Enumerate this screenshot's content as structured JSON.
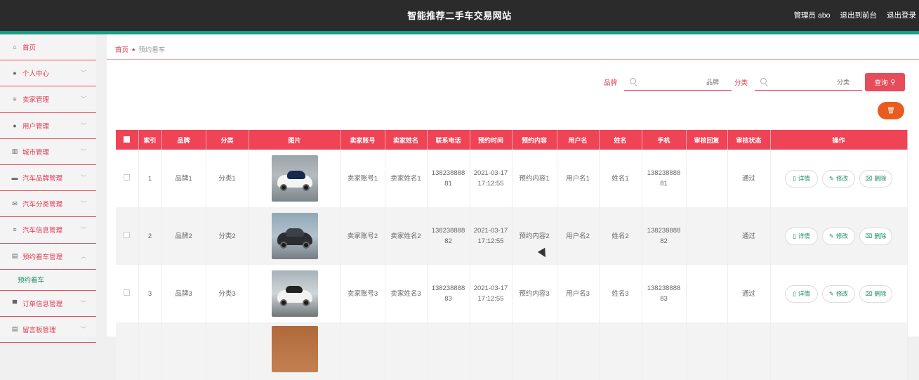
{
  "header": {
    "title": "智能推荐二手车交易网站",
    "admin": "管理员 abo",
    "back_front": "退出到前台",
    "logout": "退出登录"
  },
  "sidebar": {
    "items": [
      {
        "label": "首页",
        "icon": "home-icon",
        "chevron": false
      },
      {
        "label": "个人中心",
        "icon": "user-icon",
        "chevron": true
      },
      {
        "label": "卖家管理",
        "icon": "list-icon",
        "chevron": true
      },
      {
        "label": "用户管理",
        "icon": "user-icon",
        "chevron": true
      },
      {
        "label": "城市管理",
        "icon": "chart-icon",
        "chevron": true
      },
      {
        "label": "汽车品牌管理",
        "icon": "car-icon",
        "chevron": true
      },
      {
        "label": "汽车分类管理",
        "icon": "mail-icon",
        "chevron": true
      },
      {
        "label": "汽车信息管理",
        "icon": "list-icon",
        "chevron": true
      },
      {
        "label": "预约看车管理",
        "icon": "clipboard-icon",
        "chevron": true,
        "expanded": true
      }
    ],
    "sub_item": "预约看车",
    "items_after": [
      {
        "label": "订单信息管理",
        "icon": "print-icon",
        "chevron": true
      },
      {
        "label": "留言板管理",
        "icon": "clipboard-icon",
        "chevron": true
      }
    ]
  },
  "breadcrumb": {
    "home": "首页",
    "current": "预约看车"
  },
  "search": {
    "brand_label": "品牌",
    "brand_placeholder": "品牌",
    "category_label": "分类",
    "category_placeholder": "分类",
    "query_button": "查询"
  },
  "table": {
    "columns": [
      "索引",
      "品牌",
      "分类",
      "图片",
      "卖家账号",
      "卖家姓名",
      "联系电话",
      "预约时间",
      "预约内容",
      "用户名",
      "姓名",
      "手机",
      "审核回复",
      "审核状态",
      "操作"
    ],
    "rows": [
      {
        "index": "1",
        "brand": "品牌1",
        "category": "分类1",
        "seller_account": "卖家账号1",
        "seller_name": "卖家姓名1",
        "phone": "13823888881",
        "time": "2021-03-17 17:12:55",
        "content": "预约内容1",
        "username": "用户名1",
        "name": "姓名1",
        "mobile": "13823888881",
        "reply": "",
        "status": "通过"
      },
      {
        "index": "2",
        "brand": "品牌2",
        "category": "分类2",
        "seller_account": "卖家账号2",
        "seller_name": "卖家姓名2",
        "phone": "13823888882",
        "time": "2021-03-17 17:12:55",
        "content": "预约内容2",
        "username": "用户名2",
        "name": "姓名2",
        "mobile": "13823888882",
        "reply": "",
        "status": "通过"
      },
      {
        "index": "3",
        "brand": "品牌3",
        "category": "分类3",
        "seller_account": "卖家账号3",
        "seller_name": "卖家姓名3",
        "phone": "13823888883",
        "time": "2021-03-17 17:12:55",
        "content": "预约内容3",
        "username": "用户名3",
        "name": "姓名3",
        "mobile": "13823888883",
        "reply": "",
        "status": "通过"
      }
    ],
    "actions": {
      "detail": "详情",
      "edit": "修改",
      "delete": "删除"
    }
  },
  "colors": {
    "primary": "#ef4356",
    "teal": "#16a085",
    "delete_btn": "#ea5b1f",
    "header_bg": "#2b2b2b"
  }
}
